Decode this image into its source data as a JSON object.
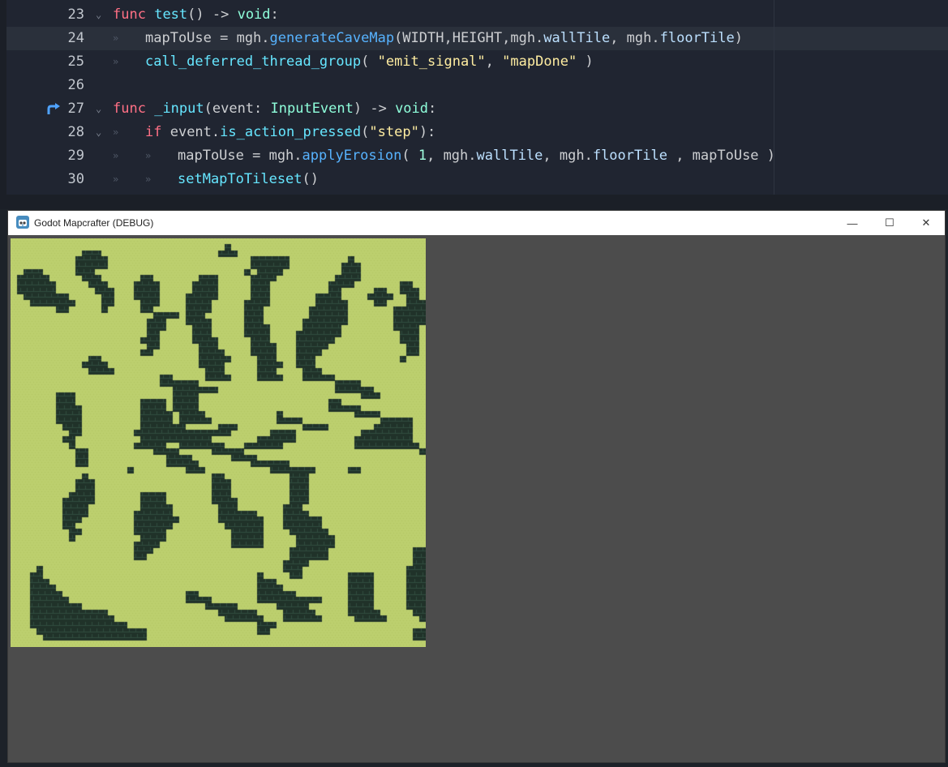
{
  "editor": {
    "current_line": "24",
    "lines": [
      {
        "num": "23",
        "indent": "",
        "parts": [
          {
            "t": "func",
            "c": "kw"
          },
          {
            "t": " "
          },
          {
            "t": "test",
            "c": "fn"
          },
          {
            "t": "() -> "
          },
          {
            "t": "void",
            "c": "ty"
          },
          {
            "t": ":"
          }
        ]
      },
      {
        "num": "24",
        "indent": "\t",
        "parts": [
          {
            "t": "mapToUse = mgh."
          },
          {
            "t": "generateCaveMap",
            "c": "mc"
          },
          {
            "t": "(WIDTH,HEIGHT,mgh."
          },
          {
            "t": "wallTile",
            "c": "pr"
          },
          {
            "t": ", mgh."
          },
          {
            "t": "floorTile",
            "c": "pr"
          },
          {
            "t": ")"
          }
        ]
      },
      {
        "num": "25",
        "indent": "\t",
        "parts": [
          {
            "t": "call_deferred_thread_group",
            "c": "fn"
          },
          {
            "t": "( "
          },
          {
            "t": "\"emit_signal\"",
            "c": "st"
          },
          {
            "t": ", "
          },
          {
            "t": "\"mapDone\"",
            "c": "st"
          },
          {
            "t": " )"
          }
        ]
      },
      {
        "num": "26",
        "indent": "",
        "parts": []
      },
      {
        "num": "27",
        "indent": "",
        "parts": [
          {
            "t": "func",
            "c": "kw"
          },
          {
            "t": " "
          },
          {
            "t": "_input",
            "c": "fn"
          },
          {
            "t": "(event: "
          },
          {
            "t": "InputEvent",
            "c": "ty"
          },
          {
            "t": ") -> "
          },
          {
            "t": "void",
            "c": "ty"
          },
          {
            "t": ":"
          }
        ]
      },
      {
        "num": "28",
        "indent": "\t",
        "parts": [
          {
            "t": "if",
            "c": "kw"
          },
          {
            "t": " event."
          },
          {
            "t": "is_action_pressed",
            "c": "fn"
          },
          {
            "t": "("
          },
          {
            "t": "\"step\"",
            "c": "st"
          },
          {
            "t": "):"
          }
        ]
      },
      {
        "num": "29",
        "indent": "\t\t",
        "parts": [
          {
            "t": "mapToUse = mgh."
          },
          {
            "t": "applyErosion",
            "c": "mc"
          },
          {
            "t": "( "
          },
          {
            "t": "1",
            "c": "nm"
          },
          {
            "t": ", mgh."
          },
          {
            "t": "wallTile",
            "c": "pr"
          },
          {
            "t": ", mgh."
          },
          {
            "t": "floorTile",
            "c": "pr"
          },
          {
            "t": " , mapToUse )"
          }
        ]
      },
      {
        "num": "30",
        "indent": "\t\t",
        "parts": [
          {
            "t": "setMapToTileset",
            "c": "fn"
          },
          {
            "t": "()"
          }
        ]
      }
    ]
  },
  "window": {
    "title": "Godot Mapcrafter (DEBUG)",
    "buttons": {
      "minimize": "—",
      "maximize": "☐",
      "close": "✕"
    }
  },
  "map": {
    "floor_color": "#bccf6e",
    "wall_color": "#203229",
    "grid": [
      "................................................................",
      ".................................#..............................",
      "...........###..................###.............................",
      "..........#####......................######.........#...........",
      "..........#####......................######........###..........",
      "..###.....###.......................#.####.........###..........",
      ".#####.....###......##.......###.....####.........####..........",
      ".######.....###....####.....####.....###.........####.......##..",
      ".######......###...####.....####.....###.........##.....##..###.",
      "..#######.....##...####....#####.....###.......####....####..##.",
      "...#######....##....###....####.....####.......#####....##...###",
      ".......##.....#.....##.....####.....###.......######.......#####",
      "......................####.###......###.......######.......#####",
      ".....................###...####.....###......#######.......#####",
      ".....................###....###.....####.....######........####.",
      ".....................##.....###.....####....#######.........###.",
      "....................###.....####.....###....######..........###.",
      ".....................##......###.....####...#####............##.",
      "....................##.......####....####...####.............##.",
      "............##...............#####....###...###.............#...",
      "...........####..............####.....####..###.................",
      "............####..............###.....###....###................",
      ".......................##.....####....####...#####..............",
      ".......................######.....................####..........",
      ".........................#######..................######........",
      ".......###...............####.........................###.......",
      ".......###..........####.####....................##.............",
      ".......####.........####.####....................#####..........",
      ".......####.........#####.####...........#...........####.......",
      ".......####.........#####.#####..........####............#####..",
      "........###.........#######.....###..........####.......######..",
      ".........##........###############......####..........########..",
      "........##..........###########.......######.........#########..",
      ".........#.........#####..#######...######...........##########.",
      "..........##..........####.....#####...........................#",
      "..........##............####......####..........................",
      "..........##............#####........######.....................",
      "..................#........###..........#######.....##..........",
      "...........#...................##..........###..................",
      "..........###..................###.........###..................",
      "..........###..................###.........###..................",
      ".........####.......####.......###.........###..................",
      "........#####.......####.......####........###..................",
      "........####........#####.......###.......###...................",
      "........####.......######.......######....####..................",
      "........###........#######......#######...######................",
      "........##.........######........######...######................",
      ".........##........#####..........#####....######...............",
      ".........#..........####..........#####.....######..............",
      "...................####...........#####.....######..............",
      "...................###.....................######.............##",
      "...................##......................######.............##",
      "..........................................####................###",
      "....#.....................................###................####",
      "...##.................................#....##.......####.....###",
      "...###................................###...........####.....###",
      "...####...............................####..........####.....###",
      "...#####...................##.........######........####.....####",
      "...######..................####.......##########....####.....####",
      "...########...................#####......#####......####.....###",
      "...############.................######....#####.....#####.....##",
      "...#############.................######...######.....#####.....#",
      "...###############....................###.......................",
      "....#################.................##......................##",
      ".....################.........................................##",
      "................................................................"
    ]
  }
}
